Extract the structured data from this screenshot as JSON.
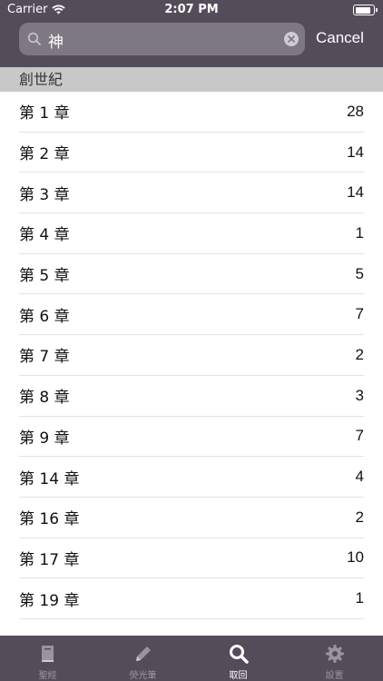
{
  "status_bar": {
    "carrier": "Carrier",
    "time": "2:07 PM",
    "battery_level": 0.9
  },
  "search": {
    "query": "神",
    "cancel_label": "Cancel"
  },
  "section": {
    "title": "創世紀"
  },
  "rows": [
    {
      "chapter": "第 1 章",
      "count": "28"
    },
    {
      "chapter": "第 2 章",
      "count": "14"
    },
    {
      "chapter": "第 3 章",
      "count": "14"
    },
    {
      "chapter": "第 4 章",
      "count": "1"
    },
    {
      "chapter": "第 5 章",
      "count": "5"
    },
    {
      "chapter": "第 6 章",
      "count": "7"
    },
    {
      "chapter": "第 7 章",
      "count": "2"
    },
    {
      "chapter": "第 8 章",
      "count": "3"
    },
    {
      "chapter": "第 9 章",
      "count": "7"
    },
    {
      "chapter": "第 14 章",
      "count": "4"
    },
    {
      "chapter": "第 16 章",
      "count": "2"
    },
    {
      "chapter": "第 17 章",
      "count": "10"
    },
    {
      "chapter": "第 19 章",
      "count": "1"
    }
  ],
  "tabs": [
    {
      "label": "聖經",
      "icon": "book-icon"
    },
    {
      "label": "熒光筆",
      "icon": "pencil-icon"
    },
    {
      "label": "取回",
      "icon": "search-icon"
    },
    {
      "label": "設置",
      "icon": "gear-icon"
    }
  ],
  "colors": {
    "bar": "#544d59",
    "search_field": "#7e7784",
    "section": "#c8c8c8",
    "tab_inactive": "#9a94a0"
  }
}
